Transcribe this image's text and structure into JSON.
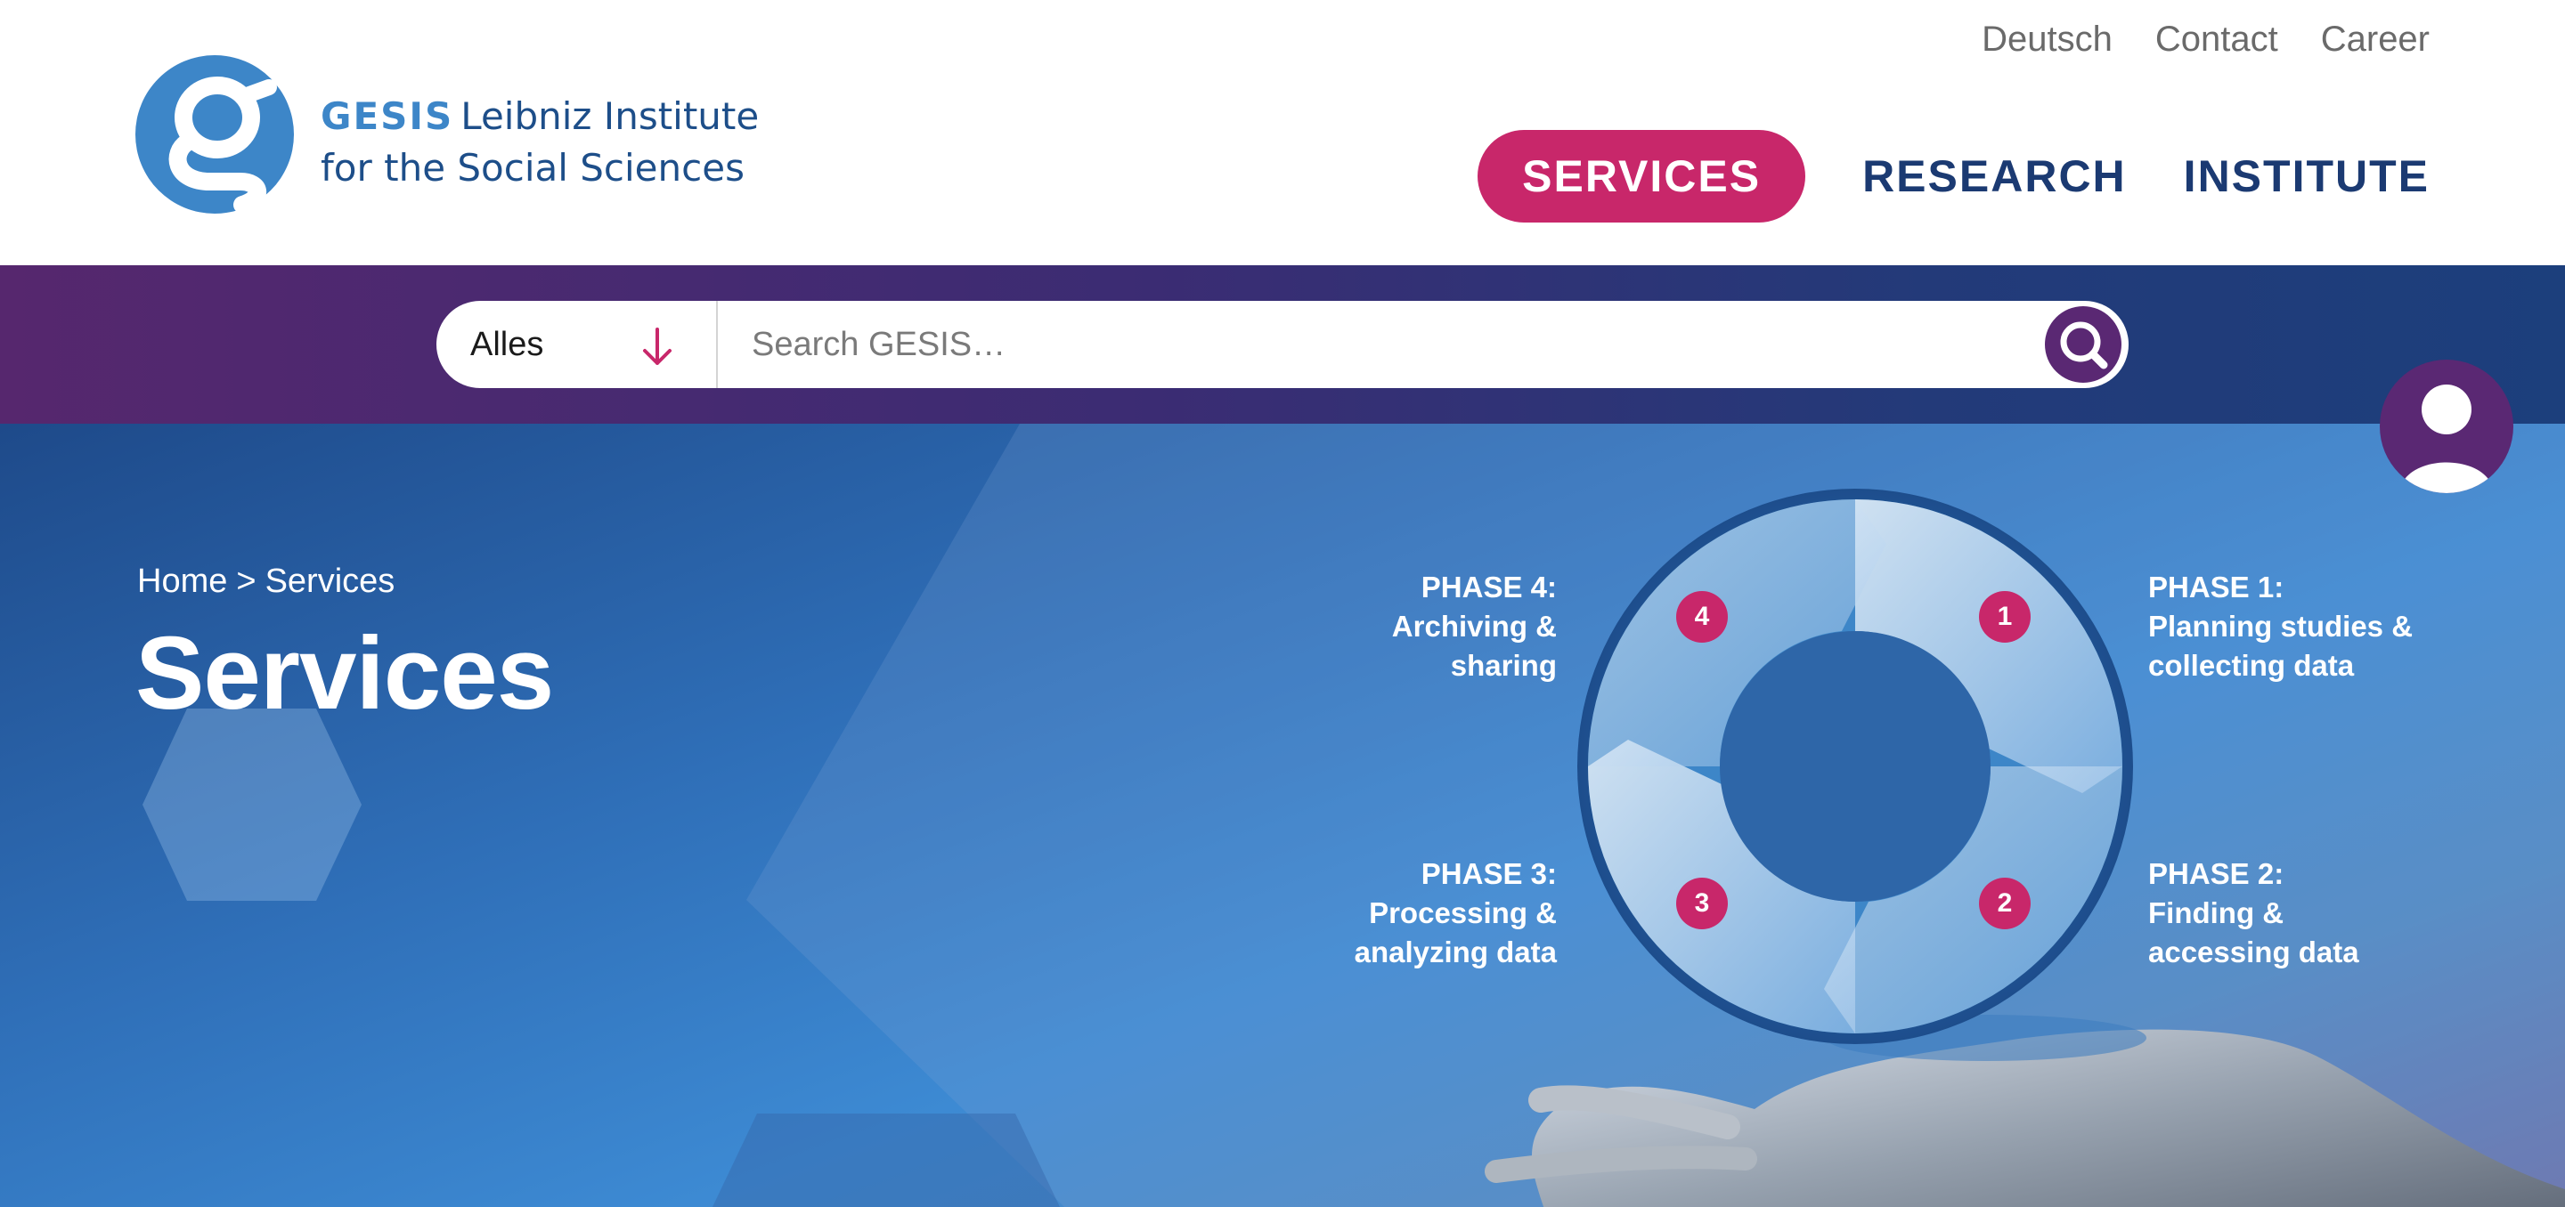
{
  "logo": {
    "brand": "GESIS",
    "line1": "Leibniz Institute",
    "line2": "for the Social Sciences"
  },
  "topnav": {
    "language": "Deutsch",
    "contact": "Contact",
    "career": "Career"
  },
  "mainnav": {
    "items": [
      {
        "label": "SERVICES",
        "active": true
      },
      {
        "label": "RESEARCH",
        "active": false
      },
      {
        "label": "INSTITUTE",
        "active": false
      }
    ]
  },
  "search": {
    "scope": "Alles",
    "placeholder": "Search GESIS…",
    "value": ""
  },
  "breadcrumb": {
    "home": "Home",
    "separator": ">",
    "current": "Services"
  },
  "page": {
    "title": "Services"
  },
  "lifecycle": {
    "phases": [
      {
        "number": "1",
        "heading": "PHASE 1:",
        "line1": "Planning studies &",
        "line2": "collecting data"
      },
      {
        "number": "2",
        "heading": "PHASE 2:",
        "line1": "Finding &",
        "line2": "accessing data"
      },
      {
        "number": "3",
        "heading": "PHASE 3:",
        "line1": "Processing &",
        "line2": "analyzing data"
      },
      {
        "number": "4",
        "heading": "PHASE 4:",
        "line1": "Archiving &",
        "line2": "sharing"
      }
    ]
  },
  "colors": {
    "accent": "#c8276a",
    "navy": "#1b3a72",
    "logo_blue": "#3d86c8",
    "purple": "#5a2873"
  },
  "icons": [
    "gesis-logo-icon",
    "arrow-down-icon",
    "search-icon",
    "user-icon"
  ]
}
